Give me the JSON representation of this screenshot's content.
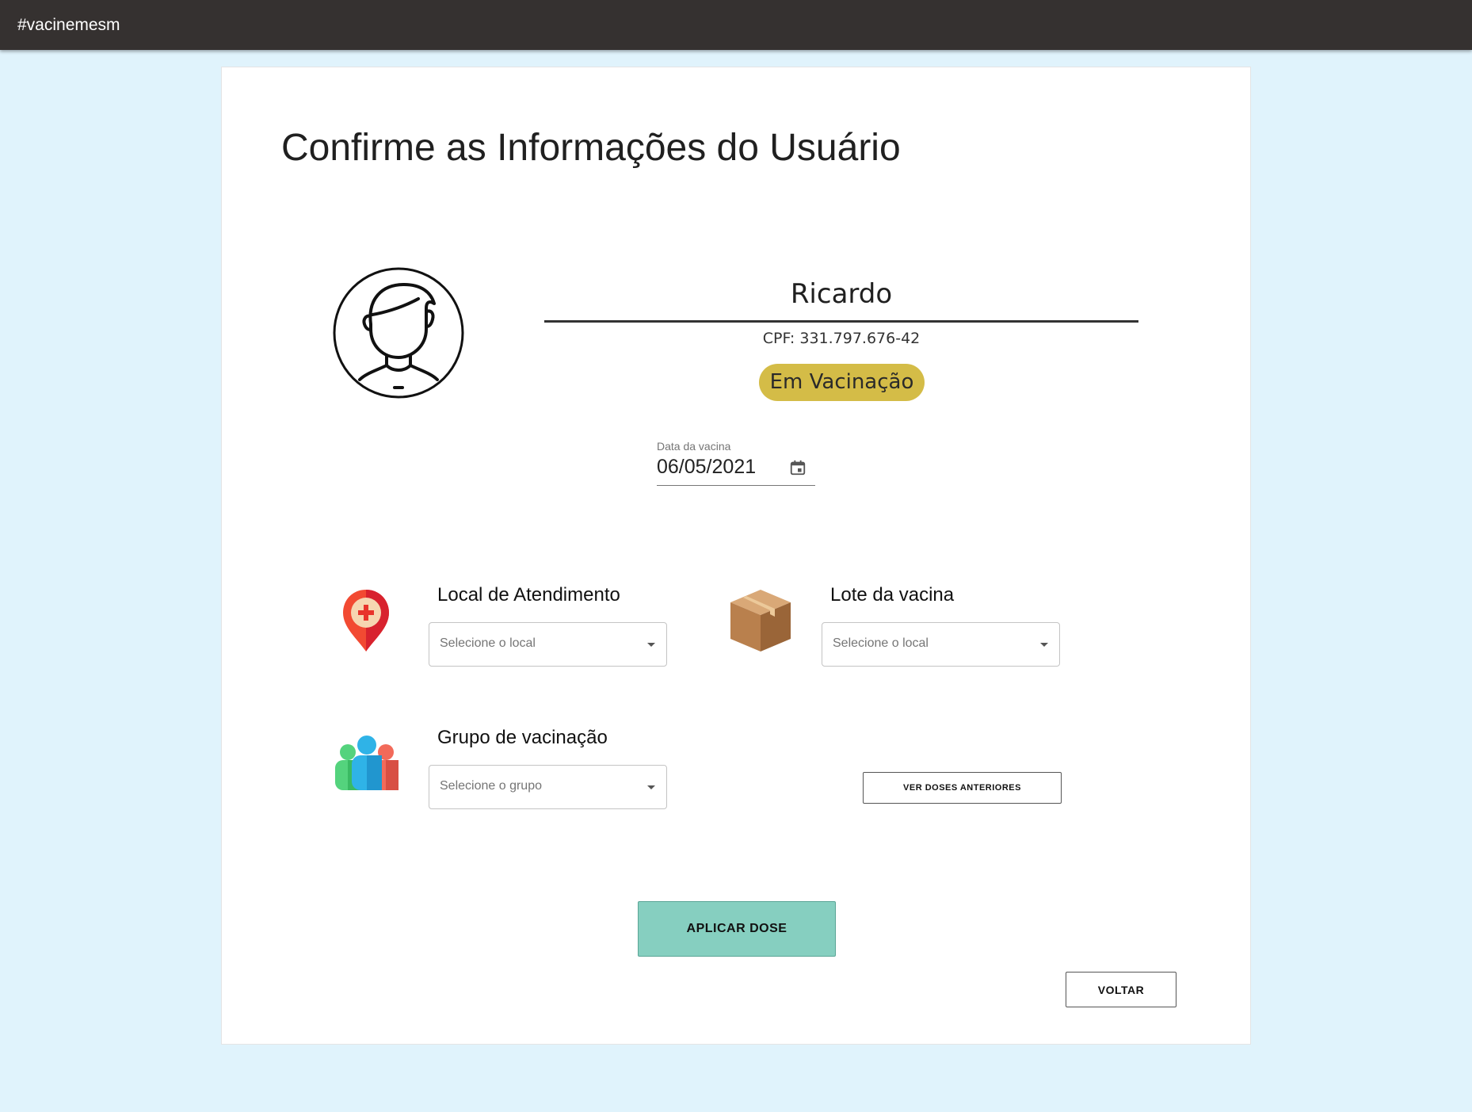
{
  "app": {
    "brand": "#vacinemesm"
  },
  "page": {
    "title": "Confirme as Informações do Usuário"
  },
  "user": {
    "name": "Ricardo",
    "cpf": "CPF: 331.797.676-42",
    "status": "Em Vacinação",
    "status_color": "#d4bc47"
  },
  "date_field": {
    "label": "Data da vacina",
    "value": "06/05/2021",
    "icon": "calendar-icon"
  },
  "local": {
    "label": "Local de Atendimento",
    "placeholder": "Selecione o local",
    "icon": "location-pin-icon"
  },
  "lote": {
    "label": "Lote da vacina",
    "placeholder": "Selecione o local",
    "icon": "box-icon"
  },
  "grupo": {
    "label": "Grupo de vacinação",
    "placeholder": "Selecione o grupo",
    "icon": "people-group-icon"
  },
  "buttons": {
    "previous_doses": "VER DOSES ANTERIORES",
    "apply": "APLICAR DOSE",
    "back": "VOLTAR"
  },
  "colors": {
    "topbar": "#353130",
    "background": "#e0f3fc",
    "apply_button": "#86cfc0"
  }
}
